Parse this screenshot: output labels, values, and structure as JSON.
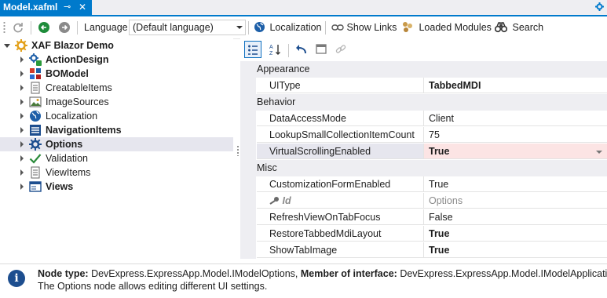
{
  "tab": {
    "title": "Model.xafml",
    "pin_glyph": "⊸",
    "close_glyph": "✕"
  },
  "toolbar": {
    "language_label": "Language",
    "language_value": "(Default language)",
    "localization_label": "Localization",
    "show_links_label": "Show Links",
    "loaded_modules_label": "Loaded Modules",
    "search_label": "Search"
  },
  "tree": {
    "root": "XAF Blazor Demo",
    "items": [
      {
        "label": "ActionDesign",
        "bold": true
      },
      {
        "label": "BOModel",
        "bold": true
      },
      {
        "label": "CreatableItems",
        "bold": false
      },
      {
        "label": "ImageSources",
        "bold": false
      },
      {
        "label": "Localization",
        "bold": false
      },
      {
        "label": "NavigationItems",
        "bold": true
      },
      {
        "label": "Options",
        "bold": true
      },
      {
        "label": "Validation",
        "bold": false
      },
      {
        "label": "ViewItems",
        "bold": false
      },
      {
        "label": "Views",
        "bold": true
      }
    ]
  },
  "property_grid": {
    "categories": {
      "appearance": "Appearance",
      "behavior": "Behavior",
      "misc": "Misc"
    },
    "rows": {
      "ui_type": {
        "name": "UIType",
        "value": "TabbedMDI"
      },
      "data_access_mode": {
        "name": "DataAccessMode",
        "value": "Client"
      },
      "lookup_small": {
        "name": "LookupSmallCollectionItemCount",
        "value": "75"
      },
      "virtual_scrolling": {
        "name": "VirtualScrollingEnabled",
        "value": "True"
      },
      "customization_form": {
        "name": "CustomizationFormEnabled",
        "value": "True"
      },
      "id": {
        "name": "Id",
        "value": "Options"
      },
      "refresh_view": {
        "name": "RefreshViewOnTabFocus",
        "value": "False"
      },
      "restore_layout": {
        "name": "RestoreTabbedMdiLayout",
        "value": "True"
      },
      "show_tab_image": {
        "name": "ShowTabImage",
        "value": "True"
      }
    }
  },
  "info": {
    "node_type_label": "Node type:",
    "node_type_value": "DevExpress.ExpressApp.Model.IModelOptions,",
    "member_label": "Member of interface:",
    "member_value": "DevExpress.ExpressApp.Model.IModelApplication",
    "description": "The Options node allows editing different UI settings."
  },
  "colors": {
    "accent": "#007acc",
    "selection": "#e6e6ee",
    "selected_value_bg": "#fce4e4"
  }
}
